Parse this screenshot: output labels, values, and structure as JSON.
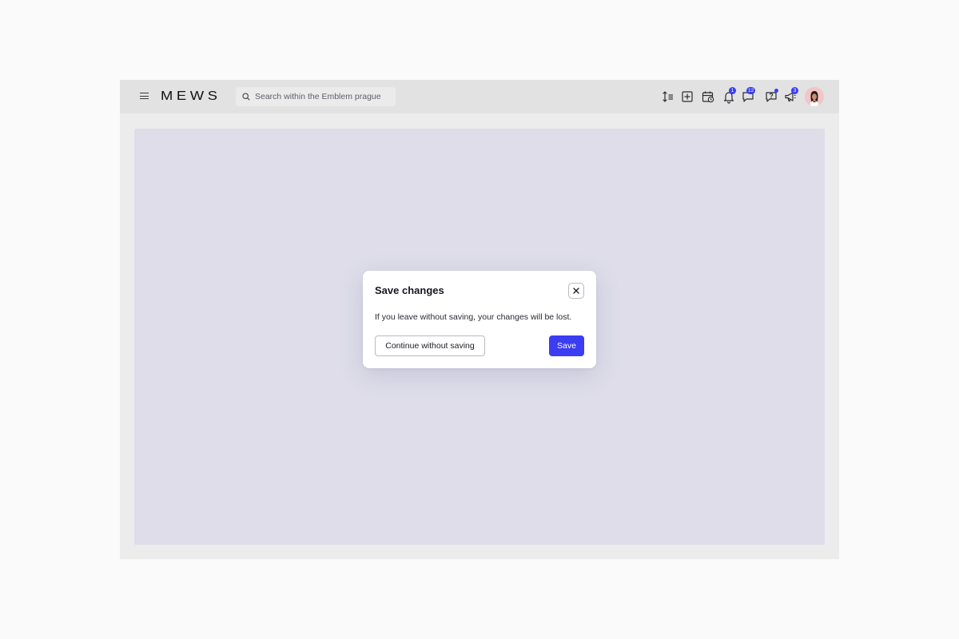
{
  "header": {
    "menu_icon": "hamburger-menu-icon",
    "logo": "MEWS",
    "search": {
      "placeholder": "Search within the Emblem prague",
      "icon": "search-icon"
    },
    "toolbar": [
      {
        "icon": "sort-lines-icon"
      },
      {
        "icon": "add-square-icon"
      },
      {
        "icon": "calendar-clock-icon"
      },
      {
        "icon": "bell-icon",
        "badge": "1"
      },
      {
        "icon": "chat-bubble-icon",
        "badge": "12"
      },
      {
        "icon": "help-chat-icon",
        "dot": true
      },
      {
        "icon": "megaphone-icon",
        "badge": "3"
      }
    ],
    "avatar": "user-avatar"
  },
  "modal": {
    "title": "Save changes",
    "close_icon": "close-icon",
    "message": "If you leave without saving, your changes will be lost.",
    "secondary_label": "Continue without saving",
    "primary_label": "Save"
  },
  "colors": {
    "accent": "#3c3df2",
    "topbar_bg": "#e2e2e2",
    "canvas_bg": "#dedde9",
    "frame_bg": "#ececec"
  }
}
